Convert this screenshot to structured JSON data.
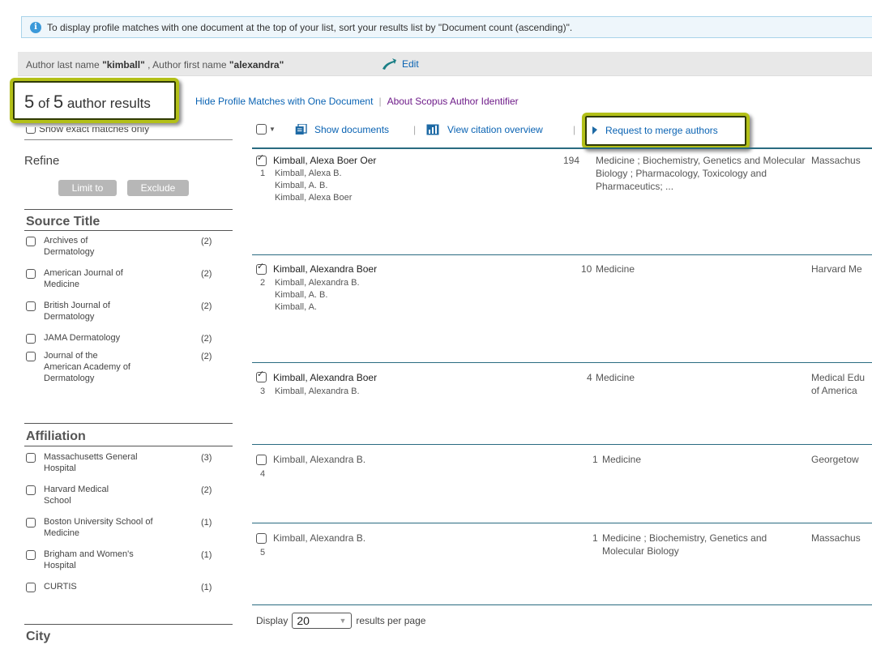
{
  "info": {
    "text": "To display profile matches with one document at the top of your list, sort your results list by \"Document count (ascending)\"."
  },
  "search": {
    "prefix_last": "Author last name ",
    "last_value": "\"kimball\"",
    "prefix_first": " , Author first name ",
    "first_value": "\"alexandra\"",
    "edit_label": "Edit"
  },
  "results": {
    "count": "5",
    "of": " of ",
    "total": "5",
    "suffix": " author results"
  },
  "links": {
    "hide_matches": "Hide Profile Matches with One Document",
    "about": "About Scopus Author Identifier"
  },
  "sidebar": {
    "show_exact": "Show exact matches only",
    "refine": "Refine",
    "limit_to": "Limit to",
    "exclude": "Exclude",
    "source_title": {
      "heading": "Source Title",
      "items": [
        {
          "label": "Archives of Dermatology",
          "count": "(2)"
        },
        {
          "label": "American Journal of Medicine",
          "count": "(2)"
        },
        {
          "label": "British Journal of Dermatology",
          "count": "(2)"
        },
        {
          "label": "JAMA Dermatology",
          "count": "(2)"
        },
        {
          "label": "Journal of the American Academy of Dermatology",
          "count": "(2)"
        }
      ]
    },
    "affiliation": {
      "heading": "Affiliation",
      "items": [
        {
          "label": "Massachusetts General Hospital",
          "count": "(3)"
        },
        {
          "label": "Harvard Medical School",
          "count": "(2)"
        },
        {
          "label": "Boston University School of Medicine",
          "count": "(1)"
        },
        {
          "label": "Brigham and Women's Hospital",
          "count": "(1)"
        },
        {
          "label": "CURTIS",
          "count": "(1)"
        }
      ]
    },
    "city": {
      "heading": "City"
    }
  },
  "toolbar": {
    "show_documents": "Show documents",
    "view_citation": "View citation overview",
    "request_merge": "Request to merge authors"
  },
  "rows": [
    {
      "num": "1",
      "name": "Kimball, Alexa Boer Oer",
      "variants": [
        "Kimball, Alexa B.",
        "Kimball, A. B.",
        "Kimball, Alexa Boer"
      ],
      "docs": "194",
      "subjects": "Medicine ; Biochemistry, Genetics and Molecular Biology ; Pharmacology, Toxicology and Pharmaceutics; ...",
      "affiliation": "Massachus",
      "checked": true
    },
    {
      "num": "2",
      "name": "Kimball, Alexandra Boer",
      "variants": [
        "Kimball, Alexandra B.",
        "Kimball, A. B.",
        "Kimball, A."
      ],
      "docs": "10",
      "subjects": "Medicine",
      "affiliation": "Harvard Me",
      "checked": true
    },
    {
      "num": "3",
      "name": "Kimball, Alexandra Boer",
      "variants": [
        "Kimball, Alexandra B."
      ],
      "docs": "4",
      "subjects": "Medicine",
      "affiliation": "Medical Edu of America",
      "checked": true
    },
    {
      "num": "4",
      "name": "Kimball, Alexandra B.",
      "variants": [],
      "docs": "1",
      "subjects": "Medicine",
      "affiliation": "Georgetow",
      "checked": false
    },
    {
      "num": "5",
      "name": "Kimball, Alexandra B.",
      "variants": [],
      "docs": "1",
      "subjects": "Medicine ; Biochemistry, Genetics and Molecular Biology",
      "affiliation": "Massachus",
      "checked": false
    }
  ],
  "footer": {
    "display": "Display",
    "per_page_value": "20",
    "suffix": "results per page"
  },
  "colors": {
    "highlight_border": "#b3c018",
    "link": "#0a63b3",
    "visited_link": "#6e1b89",
    "rule": "#2a6b81"
  }
}
